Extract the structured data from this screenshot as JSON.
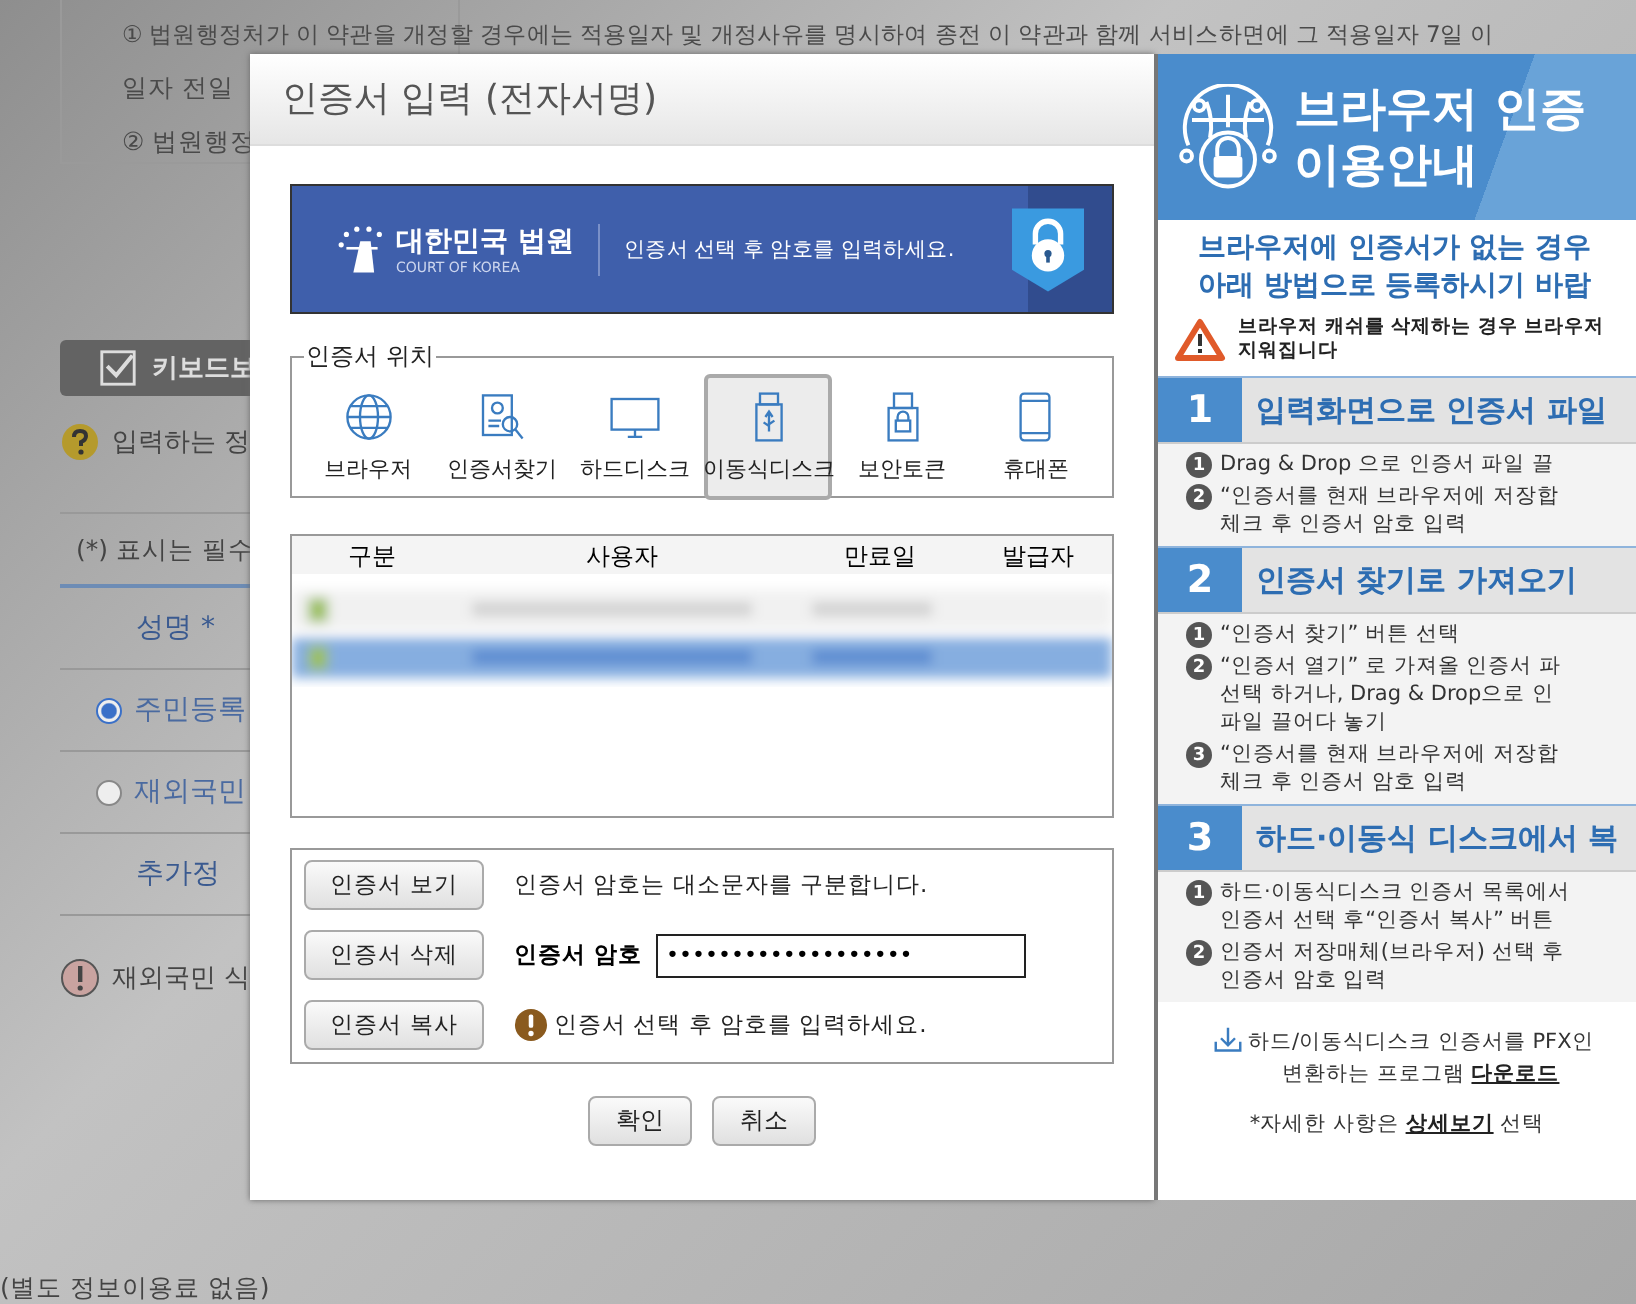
{
  "background_page": {
    "article_lines": [
      "① 법원행정처가 이 약관을 개정할 경우에는 적용일자 및 개정사유를 명시하여 종전 이 약관과 함께 서비스하면에 그 적용일자 7일 이",
      "일자 전일",
      "② 법원행정"
    ],
    "keyboard_button": {
      "label": "키보드보",
      "checked": true
    },
    "help_note": "입력하는 정",
    "required_note": "(*) 표시는 필수",
    "form_rows": [
      {
        "kind": "header",
        "label": "성명 *"
      },
      {
        "kind": "radio",
        "label": "주민등록",
        "selected": true
      },
      {
        "kind": "radio",
        "label": "재외국민",
        "selected": false
      },
      {
        "kind": "header",
        "label": "추가정"
      }
    ],
    "alert_note": "재외국민 식",
    "footer_text": "(별도 정보이용료 없음)"
  },
  "dialog": {
    "title": "인증서 입력 (전자서명)",
    "banner": {
      "org_name": "대한민국 법원",
      "org_english": "COURT OF KOREA",
      "message": "인증서 선택 후 암호를 입력하세요."
    },
    "location_group": {
      "legend": "인증서 위치",
      "locations": [
        {
          "kind": "globe",
          "label": "브라우저",
          "selected": false
        },
        {
          "kind": "certificate-search",
          "label": "인증서찾기",
          "selected": false
        },
        {
          "kind": "monitor",
          "label": "하드디스크",
          "selected": false
        },
        {
          "kind": "usb",
          "label": "이동식디스크",
          "selected": true
        },
        {
          "kind": "token",
          "label": "보안토큰",
          "selected": false
        },
        {
          "kind": "phone",
          "label": "휴대폰",
          "selected": false
        }
      ]
    },
    "cert_table": {
      "columns": [
        "구분",
        "사용자",
        "만료일",
        "발급자"
      ],
      "rows": [
        {
          "selected": false
        },
        {
          "selected": true
        }
      ]
    },
    "side_buttons": [
      "인증서 보기",
      "인증서 삭제",
      "인증서 복사"
    ],
    "case_note": "인증서 암호는 대소문자를 구분합니다.",
    "password": {
      "label": "인증서 암호",
      "value": "•••••••••••••••••••"
    },
    "warning": "인증서 선택 후 암호를 입력하세요.",
    "footer_buttons": [
      "확인",
      "취소"
    ]
  },
  "guide": {
    "title_lines": [
      "브라우저 인증",
      "이용안내"
    ],
    "intro_lines": [
      "브라우저에 인증서가 없는 경우",
      "아래 방법으로 등록하시기 바랍"
    ],
    "warning_lines": [
      "브라우저 캐쉬를 삭제하는 경우 브라우저",
      "지워집니다"
    ],
    "sections": [
      {
        "number": "1",
        "title": "입력화면으로 인증서 파일",
        "items": [
          {
            "number": "1",
            "lines": [
              "Drag & Drop 으로 인증서 파일 끌"
            ]
          },
          {
            "number": "2",
            "lines": [
              "“인증서를 현재 브라우저에 저장합",
              "체크 후 인증서 암호 입력"
            ]
          }
        ]
      },
      {
        "number": "2",
        "title": "인증서 찾기로 가져오기",
        "items": [
          {
            "number": "1",
            "lines": [
              "“인증서 찾기” 버튼 선택"
            ]
          },
          {
            "number": "2",
            "lines": [
              "“인증서 열기” 로 가져올 인증서 파",
              "선택 하거나, Drag & Drop으로 인",
              "파일 끌어다 놓기"
            ]
          },
          {
            "number": "3",
            "lines": [
              "“인증서를 현재 브라우저에 저장합",
              "체크 후 인증서 암호 입력"
            ]
          }
        ]
      },
      {
        "number": "3",
        "title": "하드·이동식 디스크에서 복",
        "items": [
          {
            "number": "1",
            "lines": [
              "하드·이동식디스크 인증서 목록에서",
              "인증서 선택 후“인증서 복사” 버튼"
            ]
          },
          {
            "number": "2",
            "lines": [
              "인증서 저장매체(브라우저) 선택 후",
              "인증서 암호 입력"
            ]
          }
        ]
      }
    ],
    "download": {
      "line": "하드/이동식디스크 인증서를 PFX인",
      "prefix": "변환하는 프로그램 ",
      "link": "다운로드"
    },
    "detail": {
      "prefix": "*자세한 사항은 ",
      "link": "상세보기",
      "suffix": " 선택"
    }
  }
}
